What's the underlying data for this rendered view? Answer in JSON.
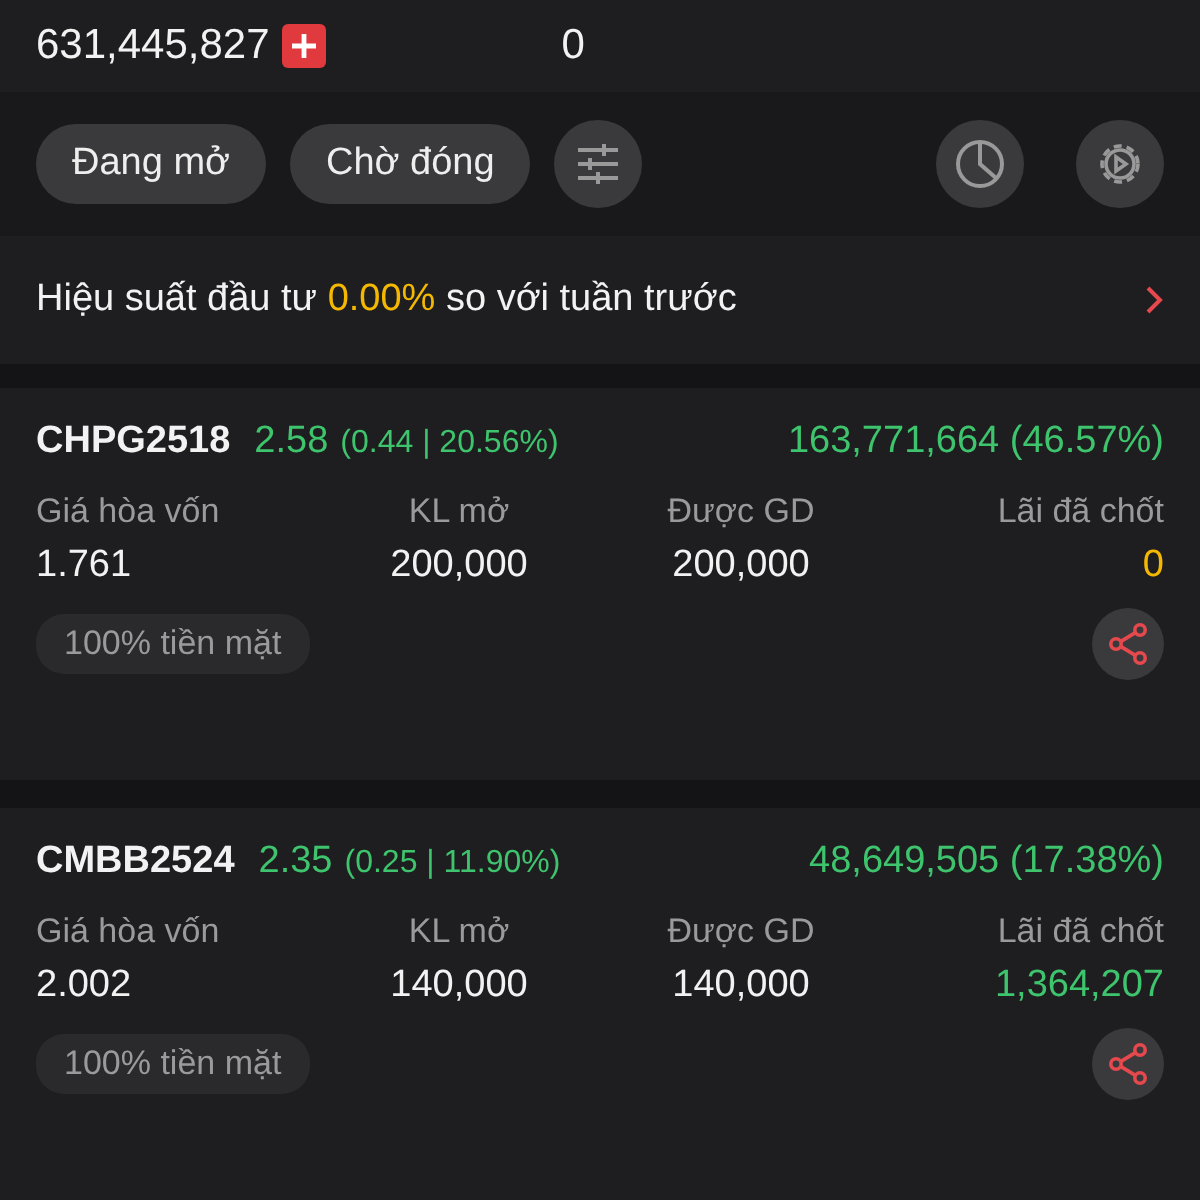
{
  "summary": {
    "total": "631,445,827",
    "secondary": "0"
  },
  "filters": [
    {
      "label": "Đang mở"
    },
    {
      "label": "Chờ đóng"
    }
  ],
  "performance": {
    "prefix": "Hiệu suất đầu tư",
    "value": "0.00%",
    "suffix": "so với tuần trước"
  },
  "positions": [
    {
      "symbol": "CHPG2518",
      "price": "2.58",
      "change": "(0.44 | 20.56%)",
      "color": "#3ec46d",
      "pnl": {
        "text": "163,771,664 (46.57%)",
        "color": "#3ec46d"
      },
      "fields": [
        {
          "label": "Giá hòa vốn",
          "value": "1.761",
          "color": "#f2f2f2"
        },
        {
          "label": "KL mở",
          "value": "200,000",
          "color": "#f2f2f2"
        },
        {
          "label": "Được GD",
          "value": "200,000",
          "color": "#f2f2f2"
        },
        {
          "label": "Lãi đã chốt",
          "value": "0",
          "color": "#f5b800"
        }
      ],
      "tag": "100% tiền mặt"
    },
    {
      "symbol": "CMBB2524",
      "price": "2.35",
      "change": "(0.25 | 11.90%)",
      "color": "#3ec46d",
      "pnl": {
        "text": "48,649,505 (17.38%)",
        "color": "#3ec46d"
      },
      "fields": [
        {
          "label": "Giá hòa vốn",
          "value": "2.002",
          "color": "#f2f2f2"
        },
        {
          "label": "KL mở",
          "value": "140,000",
          "color": "#f2f2f2"
        },
        {
          "label": "Được GD",
          "value": "140,000",
          "color": "#f2f2f2"
        },
        {
          "label": "Lãi đã chốt",
          "value": "1,364,207",
          "color": "#3ec46d"
        }
      ],
      "tag": "100% tiền mặt"
    }
  ]
}
